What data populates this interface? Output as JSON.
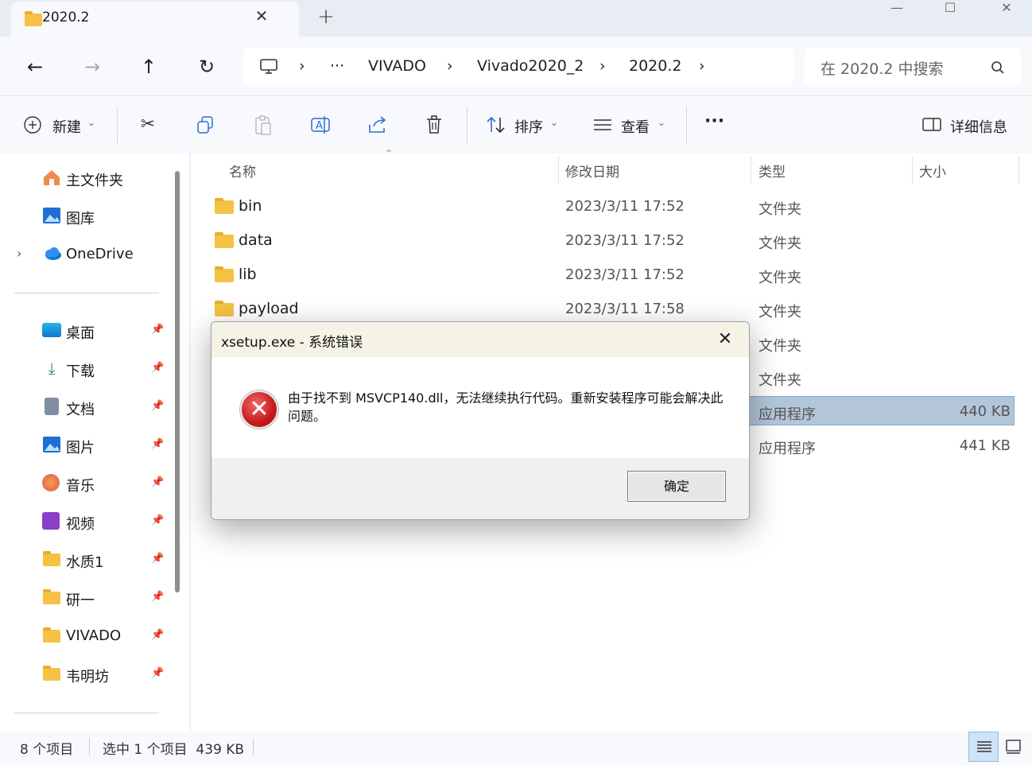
{
  "window": {
    "tab_title": "2020.2",
    "new_tab": "+",
    "controls": {
      "minimize": "—",
      "maximize": "☐",
      "close": "✕"
    }
  },
  "nav": {
    "back": "←",
    "forward": "→",
    "up": "↑",
    "refresh": "↻",
    "breadcrumb": [
      "VIVADO",
      "Vivado2020_2",
      "2020.2"
    ],
    "ellipsis": "···",
    "search_placeholder": "在 2020.2 中搜索"
  },
  "toolbar": {
    "new_label": "新建",
    "sort_label": "排序",
    "view_label": "查看",
    "more": "···",
    "details_label": "详细信息"
  },
  "sidebar": {
    "top_items": [
      {
        "label": "主文件夹",
        "icon": "home-icon"
      },
      {
        "label": "图库",
        "icon": "gallery-icon"
      },
      {
        "label": "OneDrive",
        "icon": "cloud-icon"
      }
    ],
    "quick_access": [
      {
        "label": "桌面",
        "icon": "desktop-icon"
      },
      {
        "label": "下载",
        "icon": "download-icon"
      },
      {
        "label": "文档",
        "icon": "document-icon"
      },
      {
        "label": "图片",
        "icon": "pictures-icon"
      },
      {
        "label": "音乐",
        "icon": "music-icon"
      },
      {
        "label": "视频",
        "icon": "video-icon"
      },
      {
        "label": "水质1",
        "icon": "folder-icon"
      },
      {
        "label": "研一",
        "icon": "folder-icon"
      },
      {
        "label": "VIVADO",
        "icon": "folder-icon"
      },
      {
        "label": "韦明坊",
        "icon": "folder-icon"
      }
    ]
  },
  "list": {
    "columns": [
      "名称",
      "修改日期",
      "类型",
      "大小"
    ],
    "rows": [
      {
        "name": "bin",
        "date": "2023/3/11 17:52",
        "type": "文件夹",
        "size": ""
      },
      {
        "name": "data",
        "date": "2023/3/11 17:52",
        "type": "文件夹",
        "size": ""
      },
      {
        "name": "lib",
        "date": "2023/3/11 17:52",
        "type": "文件夹",
        "size": ""
      },
      {
        "name": "payload",
        "date": "2023/3/11 17:58",
        "type": "文件夹",
        "size": ""
      },
      {
        "name": "",
        "date": "",
        "type": "文件夹",
        "size": ""
      },
      {
        "name": "",
        "date": "",
        "type": "文件夹",
        "size": ""
      },
      {
        "name": "",
        "date": "",
        "type": "应用程序",
        "size": "440 KB"
      },
      {
        "name": "",
        "date": "",
        "type": "应用程序",
        "size": "441 KB"
      }
    ]
  },
  "status": {
    "count": "8 个项目",
    "selection": "选中 1 个项目  439 KB"
  },
  "dialog": {
    "title": "xsetup.exe - 系统错误",
    "message": "由于找不到 MSVCP140.dll，无法继续执行代码。重新安装程序可能会解决此问题。",
    "ok_label": "确定",
    "close": "✕",
    "icon_glyph": "✕"
  },
  "colors": {
    "folder": "#f5c243",
    "error_red": "#c81a1a",
    "selection": "#cce2f7"
  }
}
